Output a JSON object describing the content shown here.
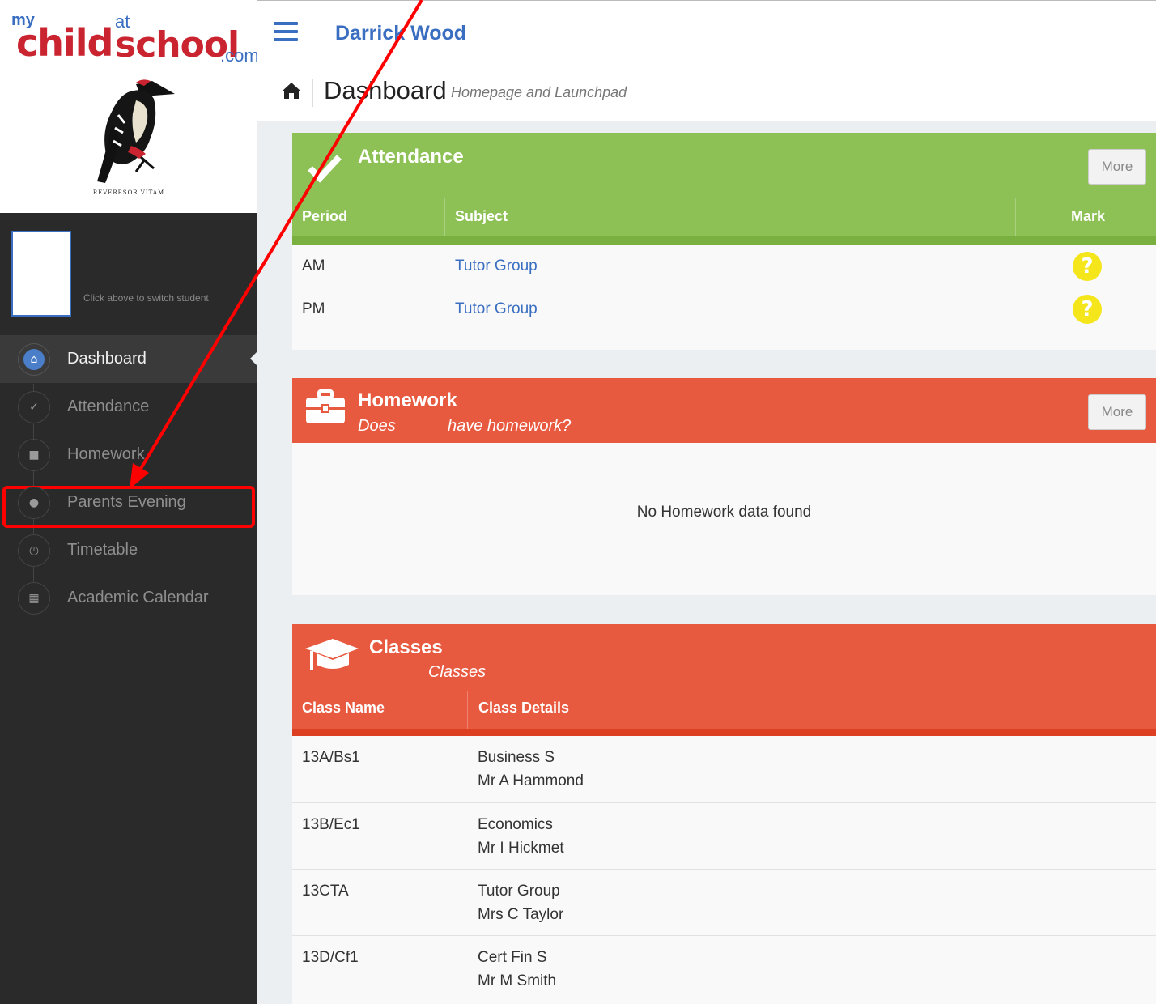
{
  "logo": {
    "my": "my",
    "child": "child",
    "at": "at",
    "school": "school",
    "com": ".com"
  },
  "crest": {
    "motto": "REVERESOR VITAM"
  },
  "student": {
    "switch_hint": "Click above to switch student"
  },
  "sidebar": {
    "items": [
      {
        "label": "Dashboard",
        "icon": "home-icon",
        "active": true
      },
      {
        "label": "Attendance",
        "icon": "check-icon",
        "active": false
      },
      {
        "label": "Homework",
        "icon": "briefcase-icon",
        "active": false
      },
      {
        "label": "Parents Evening",
        "icon": "users-icon",
        "active": false
      },
      {
        "label": "Timetable",
        "icon": "clock-icon",
        "active": false
      },
      {
        "label": "Academic Calendar",
        "icon": "calendar-icon",
        "active": false
      }
    ]
  },
  "header": {
    "school_name": "Darrick Wood"
  },
  "breadcrumb": {
    "title": "Dashboard",
    "subtitle": "Homepage and Launchpad"
  },
  "attendance": {
    "title": "Attendance",
    "more_label": "More",
    "columns": [
      "Period",
      "Subject",
      "Mark"
    ],
    "rows": [
      {
        "period": "AM",
        "subject": "Tutor Group",
        "mark": "?"
      },
      {
        "period": "PM",
        "subject": "Tutor Group",
        "mark": "?"
      }
    ]
  },
  "homework": {
    "title": "Homework",
    "subtitle_a": "Does",
    "subtitle_b": "have homework?",
    "more_label": "More",
    "empty_text": "No Homework data found"
  },
  "classes": {
    "title": "Classes",
    "subtitle": "Classes",
    "columns": [
      "Class Name",
      "Class Details"
    ],
    "rows": [
      {
        "name": "13A/Bs1",
        "subject": "Business S",
        "teacher": "Mr A Hammond"
      },
      {
        "name": "13B/Ec1",
        "subject": "Economics",
        "teacher": "Mr I Hickmet"
      },
      {
        "name": "13CTA",
        "subject": "Tutor Group",
        "teacher": "Mrs C Taylor"
      },
      {
        "name": "13D/Cf1",
        "subject": "Cert Fin S",
        "teacher": "Mr M Smith"
      }
    ]
  },
  "colors": {
    "sidebar_bg": "#2a2a2a",
    "brand_blue": "#3a6ec1",
    "attendance_green": "#8dc156",
    "homework_red": "#e85a40",
    "annotation_red": "#ff0000",
    "mark_yellow": "#f4e61a"
  }
}
